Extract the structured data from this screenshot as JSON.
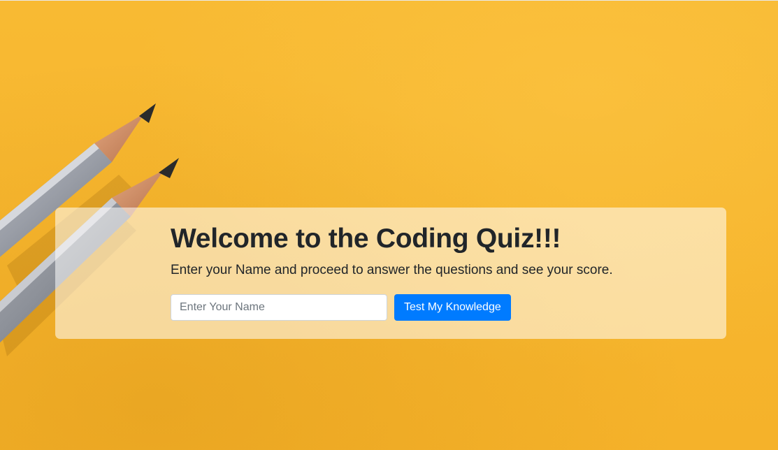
{
  "jumbotron": {
    "title": "Welcome to the Coding Quiz!!!",
    "lead": "Enter your Name and proceed to answer the questions and see your score.",
    "name_input": {
      "value": "",
      "placeholder": "Enter Your Name"
    },
    "submit_label": "Test My Knowledge"
  },
  "colors": {
    "background": "#f7b62c",
    "button": "#007bff",
    "text": "#212529"
  }
}
